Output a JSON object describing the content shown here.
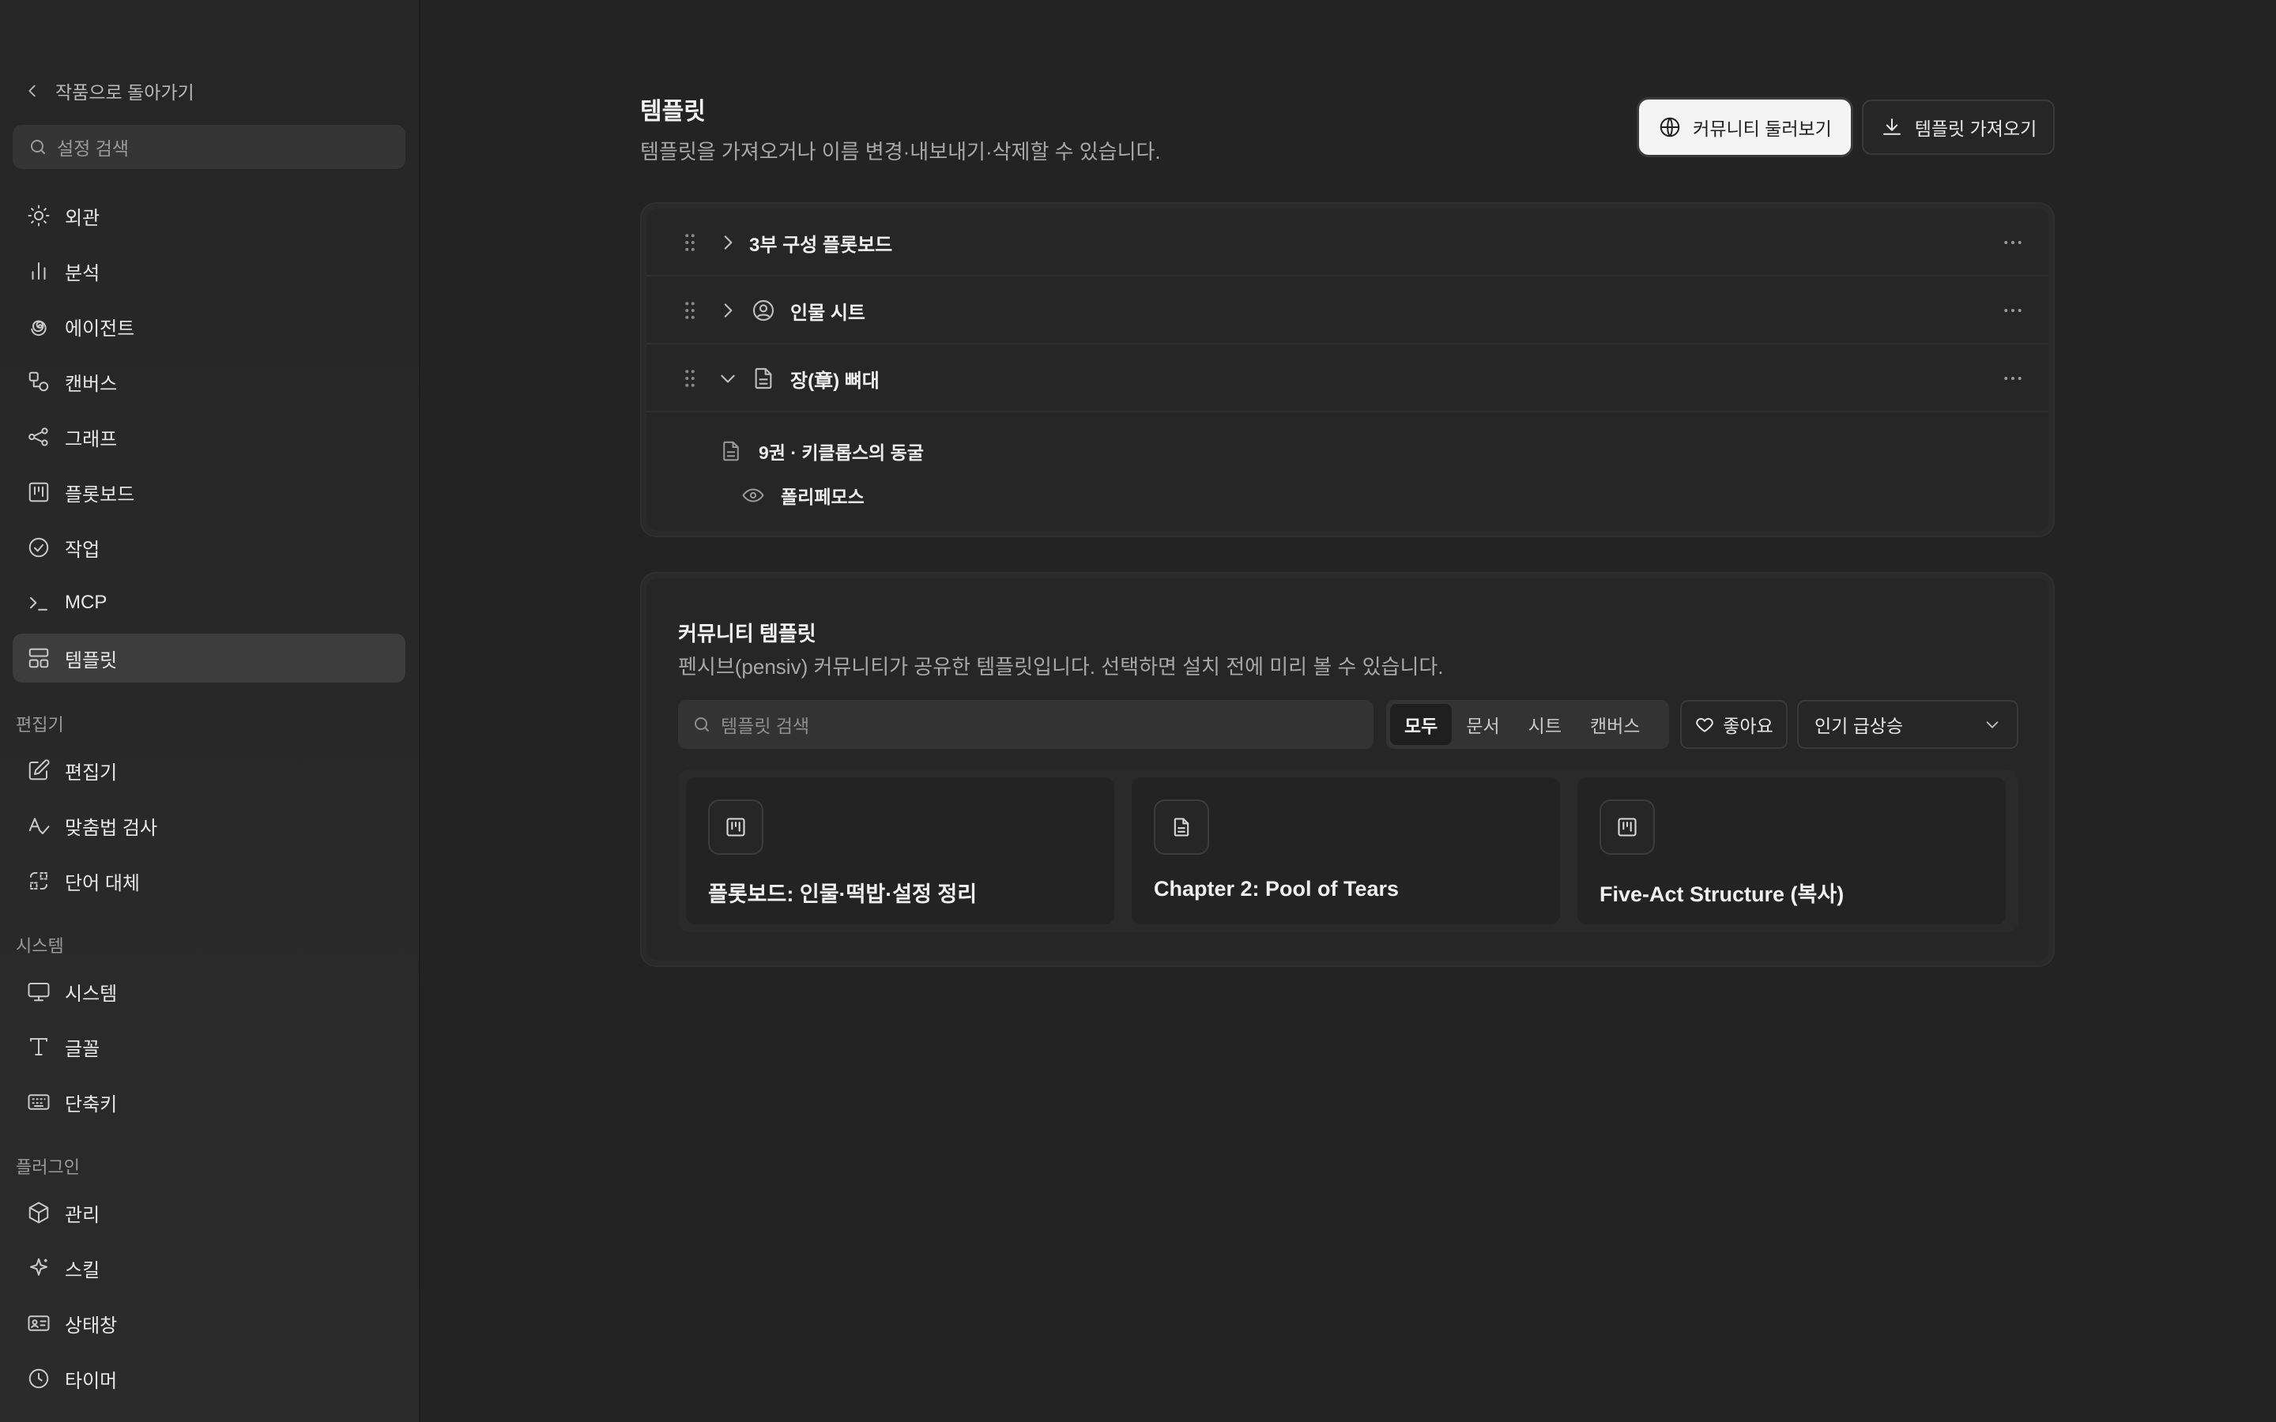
{
  "sidebar": {
    "back_label": "작품으로 돌아가기",
    "search_placeholder": "설정 검색",
    "items_general": [
      {
        "label": "외관",
        "icon": "sun-icon"
      },
      {
        "label": "분석",
        "icon": "bar-chart-icon"
      },
      {
        "label": "에이전트",
        "icon": "spiral-icon"
      },
      {
        "label": "캔버스",
        "icon": "shapes-icon"
      },
      {
        "label": "그래프",
        "icon": "graph-icon"
      },
      {
        "label": "플롯보드",
        "icon": "kanban-icon"
      },
      {
        "label": "작업",
        "icon": "check-circle-icon"
      },
      {
        "label": "MCP",
        "icon": "terminal-icon"
      },
      {
        "label": "템플릿",
        "icon": "layout-icon",
        "active": true
      }
    ],
    "section_editor": "편집기",
    "items_editor": [
      {
        "label": "편집기",
        "icon": "edit-icon"
      },
      {
        "label": "맞춤법 검사",
        "icon": "spellcheck-icon"
      },
      {
        "label": "단어 대체",
        "icon": "replace-icon"
      }
    ],
    "section_system": "시스템",
    "items_system": [
      {
        "label": "시스템",
        "icon": "monitor-icon"
      },
      {
        "label": "글꼴",
        "icon": "type-icon"
      },
      {
        "label": "단축키",
        "icon": "keyboard-icon"
      }
    ],
    "section_plugins": "플러그인",
    "items_plugins": [
      {
        "label": "관리",
        "icon": "package-icon"
      },
      {
        "label": "스킬",
        "icon": "sparkle-icon"
      },
      {
        "label": "상태창",
        "icon": "id-card-icon"
      },
      {
        "label": "타이머",
        "icon": "clock-icon"
      }
    ]
  },
  "header": {
    "title": "템플릿",
    "description": "템플릿을 가져오거나 이름 변경·내보내기·삭제할 수 있습니다.",
    "community_button": "커뮤니티 둘러보기",
    "import_button": "템플릿 가져오기"
  },
  "templates": [
    {
      "name": "3부 구성 플롯보드",
      "expanded": false,
      "icon": ""
    },
    {
      "name": "인물 시트",
      "expanded": false,
      "icon": "user-circle-icon"
    },
    {
      "name": "장(章) 뼈대",
      "expanded": true,
      "icon": "document-icon"
    }
  ],
  "template_children": [
    {
      "name": "9권 · 키클롭스의 동굴",
      "icon": "document-icon"
    },
    {
      "name": "폴리페모스",
      "icon": "eye-icon"
    }
  ],
  "community": {
    "title": "커뮤니티 템플릿",
    "description": "펜시브(pensiv) 커뮤니티가 공유한 템플릿입니다. 선택하면 설치 전에 미리 볼 수 있습니다.",
    "search_placeholder": "템플릿 검색",
    "filters": [
      "모두",
      "문서",
      "시트",
      "캔버스"
    ],
    "active_filter": "모두",
    "like_button": "좋아요",
    "sort_value": "인기 급상승",
    "cards": [
      {
        "title": "플롯보드: 인물·떡밥·설정 정리",
        "icon": "kanban-icon"
      },
      {
        "title": "Chapter 2: Pool of Tears",
        "icon": "document-icon"
      },
      {
        "title": "Five-Act Structure (복사)",
        "icon": "kanban-icon"
      }
    ]
  }
}
